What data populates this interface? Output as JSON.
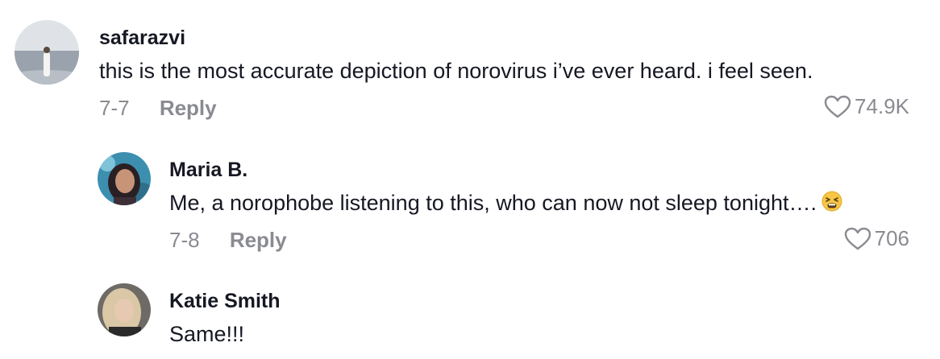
{
  "comments": [
    {
      "username": "safarazvi",
      "text": "this is the most accurate depiction of norovirus i’ve ever heard. i feel seen.",
      "date": "7-7",
      "reply_label": "Reply",
      "likes": "74.9K",
      "avatar": "beach-photo"
    },
    {
      "username": "Maria B.",
      "text": "Me, a norophobe listening to this, who can now not sleep tonight….",
      "emoji": "tired-face-emoji",
      "date": "7-8",
      "reply_label": "Reply",
      "likes": "706",
      "avatar": "portrait-photo"
    },
    {
      "username": "Katie Smith",
      "text": "Same!!!",
      "avatar": "portrait-photo"
    }
  ],
  "colors": {
    "text": "#161823",
    "secondary": "#8a8b91"
  }
}
